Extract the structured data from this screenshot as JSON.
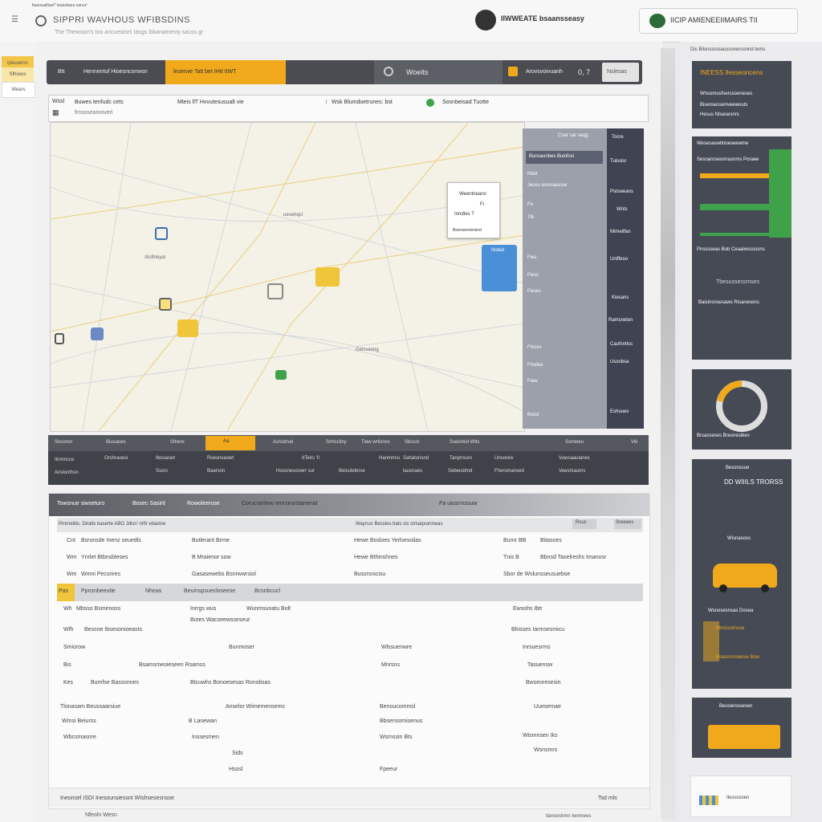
{
  "header": {
    "breadcrumb": "fasessalltanf\" teasstwes nanur!",
    "title": "SIPPRI WAVHOUS WFIBSDINS",
    "subtitle": "The Thewsion's too ancuestors tasgs ibkanamenty sauss gr",
    "brand_a": "IIWWEATE bsaansseasy",
    "brand_b": "IICIP AMIENEEIIMAIRS TII"
  },
  "leftstrip": {
    "tabs": [
      "lpleuwrnn",
      "Sfhiows",
      "Wears"
    ]
  },
  "toolbar": {
    "label1": "Btt",
    "label2": "Hennentuf Hioesnconwsn",
    "active_tab": "leserwe Tatt bet IHtt tIWT",
    "search_label": "Woeits",
    "count_label": "Arovsvoivuanh",
    "count_value": "0, 7",
    "button": "Nslesas"
  },
  "filters": {
    "f1": "Buwes tenfudc cets",
    "f1b": "fmsoseamoveri",
    "f2": "Mteis llT Hvvutesusualt vie",
    "f3": "Wsk Blumdoetrunes: bst",
    "f4": "Sosnbeisad Tuotte",
    "label_a": "Wssl"
  },
  "map": {
    "callout_title": "Weentnearsr",
    "callout_line1": "Fi",
    "callout_line2": "Inndtes T",
    "callout_line3": "Boenseeotnisnd",
    "pin_label": "Noted",
    "places": [
      "Alsthteyal",
      "uesehqcl",
      "Gelsvanng"
    ]
  },
  "slide_panel": {
    "title": "Cnar sar seqg",
    "sub": "Bunsaunbes Buinfssi",
    "items": [
      "Ihilot",
      "Jeoss wrossauruw",
      "Fe",
      "Tib",
      "Fies",
      "Paso",
      "Pases",
      "Fhises",
      "Fhsdes",
      "Fiaw",
      "Bsloz"
    ],
    "right_items": [
      "Tocre",
      "Tuisslsr",
      "Pstsweans",
      "Wnts",
      "Mimeilfan",
      "Uniffeso",
      "Kiesans",
      "Ramsnelon",
      "Caufsntlss",
      "Ussnbsa",
      "Eshuues"
    ]
  },
  "grid": {
    "headers": [
      "Snconor",
      "Biusaoes",
      "Sthere",
      "Aa",
      "Acrodrsel",
      "Snhscliny",
      "Tlaw wrilsnvs",
      "Sbcsol",
      "Sseclniol Wlts",
      "Ssmweu",
      "Vkl"
    ],
    "row1": [
      "Ikrmncce",
      "Orshraoesi",
      "Ibouaswt",
      "Roesnvaowt",
      "ItTeirs 'Il",
      "Hanmnnu",
      "Sahatorisnd",
      "Tanprisuro",
      "Unsoreiv",
      "Vuwsaaulanes"
    ],
    "row2": [
      "Anslonthsn",
      "Ssorc",
      "Baarsnn",
      "Hsosnesoswrr sur",
      "Beisulebnse",
      "lausnaes",
      "Sebeuidmd",
      "Fhersmansed",
      "Veesmaunrs"
    ]
  },
  "table": {
    "head_label": "Towsnue siwseturo",
    "head_label2": "Bosec Sasirit",
    "head_label3": "Rowoleeruse",
    "head_label4": "Corucrantew renrseurstanenal",
    "head_right": "Fa uiusrrnssuw",
    "subhead": "Pmrneillis, Diralts baserte ABO Jdisn' rirfir etiastne",
    "subhead2": "Wayrssr Bessles bats sis stmaiprannwas",
    "chip1": "Rsus",
    "chip2": "Sreeees",
    "rows": [
      [
        "Cnt",
        "Bsronsde Inenz seuedls",
        "Butlerant Brrne",
        "Hewe Bosloes Yerlsesoilas",
        "Burnr BB",
        "Bitasoes"
      ],
      [
        "Wrn",
        "Ynrlet Btbnsbleses",
        "B Mraienor sow",
        "Hewe Bthinshnes",
        "Tnis B",
        "Bbnsd Taselreshs Imanosr"
      ],
      [
        "Wm",
        "Wmni Pecsrires",
        "Gasasewebs Bsnrwwrsiol",
        "Bussrsnicisu",
        "Sbor de Wslunsseusuebse"
      ]
    ],
    "sect_tabs": [
      "Pas",
      "Ppnsnbeeutie",
      "Nheas",
      "Beuinspsuecloseese",
      "Bcsnbcucl"
    ],
    "rows2": [
      [
        "Wh",
        "Mbsso Bsmenoss",
        "Inrrgs wus",
        "Wunmsunatu Bolt",
        "Ewsohs Ibtr"
      ],
      [
        "Wfh",
        "Bessne Ibsesonioeasts",
        "Bhisses Iarmsesmicu",
        "Butes Wacseewsseseur"
      ],
      [
        "Smiorow",
        "Bunmoser",
        "Wlssuenwre",
        "Inrsuesrms"
      ],
      [
        "Bis",
        "Bsamsmeoieseen Rsamss",
        "Mnrsns",
        "Tasuensw"
      ],
      [
        "Kes",
        "Bumfse Basssnnes",
        "Btcuwhs Bonoesesas Ronsbsas",
        "Bwseoresesin"
      ],
      [
        "Tlonasam Beussaarsiue",
        "Anselor Wimemensems",
        "Benoucommsl",
        "Uuesemae"
      ],
      [
        "Wmsi Beiurss",
        "B Lanewan",
        "Bbsensomisenus",
        "Wismnsen Iks"
      ],
      [
        "Wbcsmasnre",
        "Inssesmen",
        "Wsmssin Bts",
        "Wsnsmrs"
      ],
      [
        "Sids",
        "Hsosl",
        "Fpeeur"
      ]
    ],
    "footer_left": "Ineonsel ISDI Inesounsiessnt WIshsesesnsoe",
    "footer_right": "Tsd mls",
    "bottom_left": "Nfeoln Wesn",
    "bottom_right": "tlanseshmn Iwnmees"
  },
  "widgets": {
    "top_note": "Dis Bilsnssrusacusonersonnd tems",
    "w1_title": "INEESS Ilesseoncens",
    "w1_lines": [
      "Wnsomusfserssoeneses",
      "Bisensessenveewouts",
      "Hesus Ntsesesnrs"
    ],
    "w2_title": "Wesesaswtirioeseewme",
    "w2_sub": "Sesoarosesmrasnms Poraee",
    "w2_caption": "Pnsssseas Bob Ceaaiwsssosns",
    "w2_label": "Tbesussessmses",
    "w2_foot": "Baisinsnsesaws Risanesens",
    "w3_caption": "Brsasseses Bresnestkes",
    "w4_title": "Bessnssue",
    "w4_big": "DD WIIILS TRORSS",
    "w4_sub": "Wisnasoss",
    "w4_mid": "Wsnosesnsas Dosea",
    "w4_chip": "Mnrissomsse",
    "w4_foot": "Bsasrmsneesw Bow",
    "w5_title": "Beoslenosenen",
    "w6_text": "Ilessssnen",
    "accent": "#f0a91b",
    "green": "#3fa24b",
    "dark": "#464a55"
  }
}
